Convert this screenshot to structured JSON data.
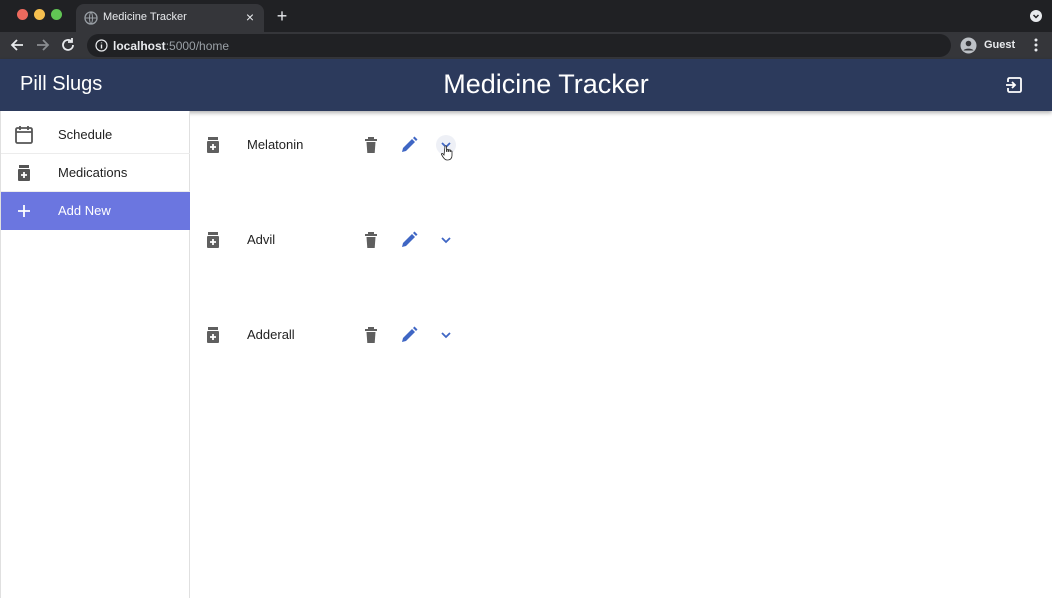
{
  "browser": {
    "tab_title": "Medicine Tracker",
    "tab_close": "×",
    "new_tab": "+",
    "url_host": "localhost",
    "url_path": ":5000/home",
    "profile_label": "Guest"
  },
  "app": {
    "brand": "Pill Slugs",
    "title": "Medicine Tracker",
    "colors": {
      "header": "#2c3a5c",
      "active_nav": "#6b76e0",
      "accent_icon": "#3f66c4"
    }
  },
  "sidebar": {
    "items": [
      {
        "label": "Schedule",
        "icon": "calendar-icon",
        "active": false
      },
      {
        "label": "Medications",
        "icon": "medication-icon",
        "active": false
      },
      {
        "label": "Add New",
        "icon": "plus-icon",
        "active": true
      }
    ]
  },
  "medications": [
    {
      "name": "Melatonin"
    },
    {
      "name": "Advil"
    },
    {
      "name": "Adderall"
    }
  ]
}
